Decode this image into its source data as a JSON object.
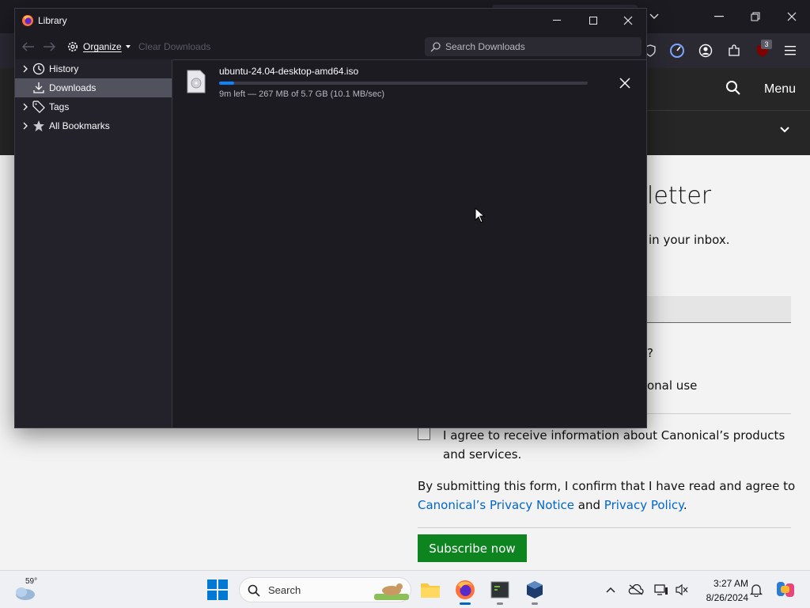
{
  "library": {
    "title": "Library",
    "toolbar": {
      "organize_label": "Organize",
      "clear_downloads_label": "Clear Downloads",
      "search_placeholder": "Search Downloads"
    },
    "sidebar": {
      "items": [
        {
          "label": "History",
          "icon": "clock-icon",
          "selected": false
        },
        {
          "label": "Downloads",
          "icon": "download-icon",
          "selected": true
        },
        {
          "label": "Tags",
          "icon": "tag-icon",
          "selected": false
        },
        {
          "label": "All Bookmarks",
          "icon": "star-icon",
          "selected": false
        }
      ]
    },
    "downloads": [
      {
        "file_name": "ubuntu-24.04-desktop-amd64.iso",
        "progress": 0.04,
        "status": "9m left — 267 MB of 5.7 GB (10.1 MB/sec)"
      }
    ]
  },
  "browser": {
    "extension_badge": "3",
    "site_header": {
      "menu_label": "Menu"
    },
    "page": {
      "heading_fragment": "letter",
      "subheading_fragment": "in your inbox.",
      "question_fragment": "?",
      "option_fragment": "onal use",
      "agree_text": "I agree to receive information about Canonical’s products and services.",
      "legal_prefix": "By submitting this form, I confirm that I have read and agree to",
      "legal_link_1": "Canonical’s Privacy Notice",
      "legal_and": "and",
      "legal_link_2": "Privacy Policy",
      "legal_suffix": ".",
      "subscribe_label": "Subscribe now"
    }
  },
  "taskbar": {
    "weather_temp": "59°",
    "search_label": "Search",
    "clock_time": "3:27 AM",
    "clock_date": "8/26/2024"
  },
  "colors": {
    "accent_blue": "#0a84ff",
    "subscribe_green": "#0e8420",
    "link_blue": "#0066cc"
  }
}
